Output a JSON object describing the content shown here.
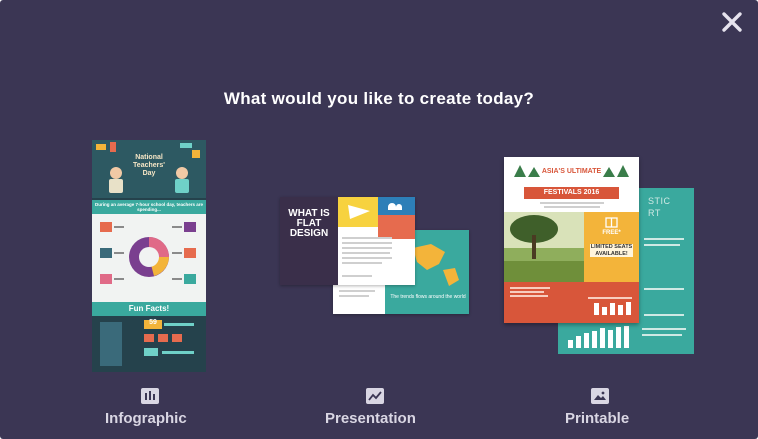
{
  "dialog": {
    "title": "What would you like to create today?",
    "close_icon": "close-icon"
  },
  "options": [
    {
      "label": "Infographic",
      "icon": "bar-chart-icon"
    },
    {
      "label": "Presentation",
      "icon": "line-chart-icon"
    },
    {
      "label": "Printable",
      "icon": "image-icon"
    }
  ],
  "infographic_thumb": {
    "title": "National Teachers' Day",
    "subtitle": "During an average 7-hour school day, teachers are spending...",
    "stat": "59",
    "fun_facts": "Fun Facts!"
  },
  "presentation_thumb": {
    "title": "WHAT IS FLAT DESIGN",
    "caption": "The trends flows around the world"
  },
  "printable_thumb": {
    "title": "ASIA'S ULTIMATE",
    "banner": "FESTIVALS 2016",
    "free": "FREE*",
    "seats": "LIMITED SEATS AVAILABLE!",
    "back_title": "STIC",
    "back_title_2": "RT"
  },
  "colors": {
    "background": "#3b3654",
    "text": "#ffffff",
    "label": "#d9d6e3",
    "teal": "#3aa99e",
    "orange": "#d8563a"
  }
}
